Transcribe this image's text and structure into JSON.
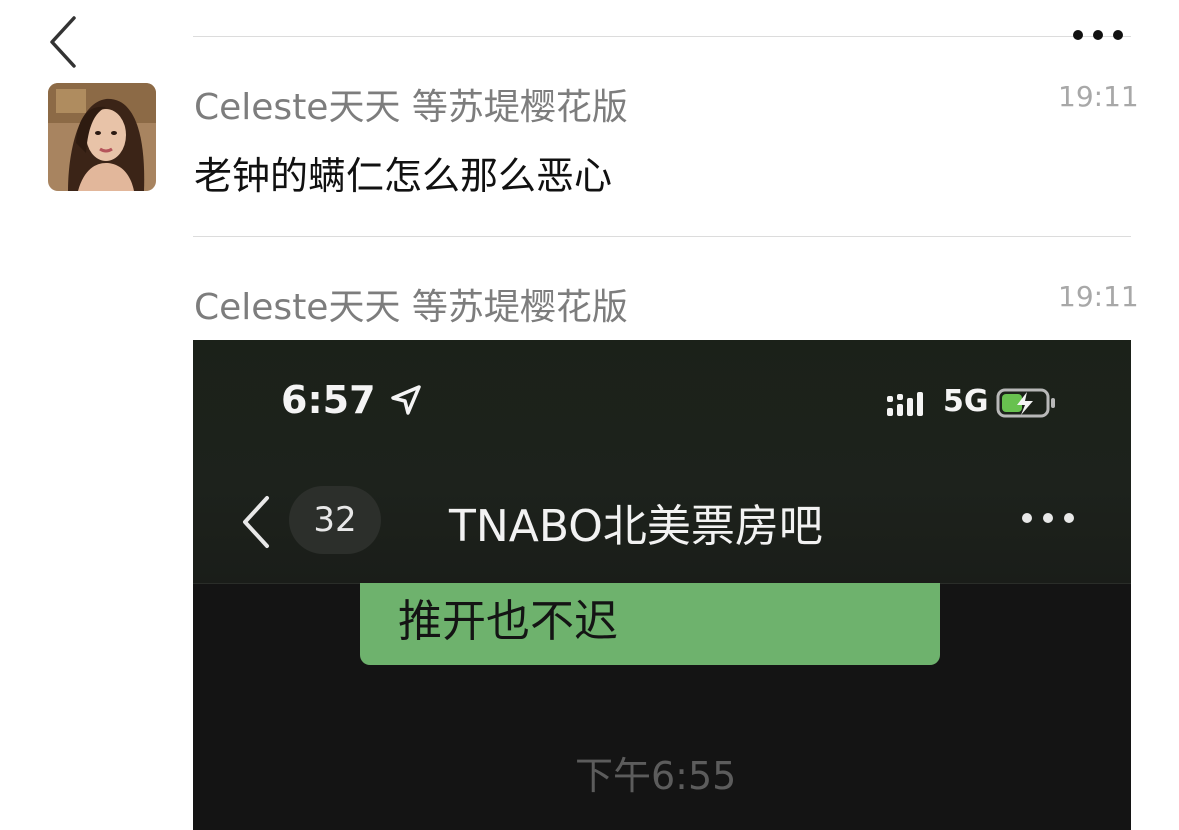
{
  "top_bar": {
    "back_icon": "chevron-left-icon",
    "more_icon": "more-horizontal-icon"
  },
  "messages": [
    {
      "sender": "Celeste天天 等苏堤樱花版",
      "time": "19:11",
      "text": "老钟的螨仁怎么那么恶心"
    },
    {
      "sender": "Celeste天天 等苏堤樱花版",
      "time": "19:11"
    }
  ],
  "embedded_screenshot": {
    "status_time": "6:57",
    "network": "5G",
    "unread_count": "32",
    "chat_title": "TNABO北美票房吧",
    "bubble_text": "推开也不迟",
    "timestamp": "下午6:55",
    "colors": {
      "bubble": "#6eb26d",
      "background": "#141414"
    }
  }
}
